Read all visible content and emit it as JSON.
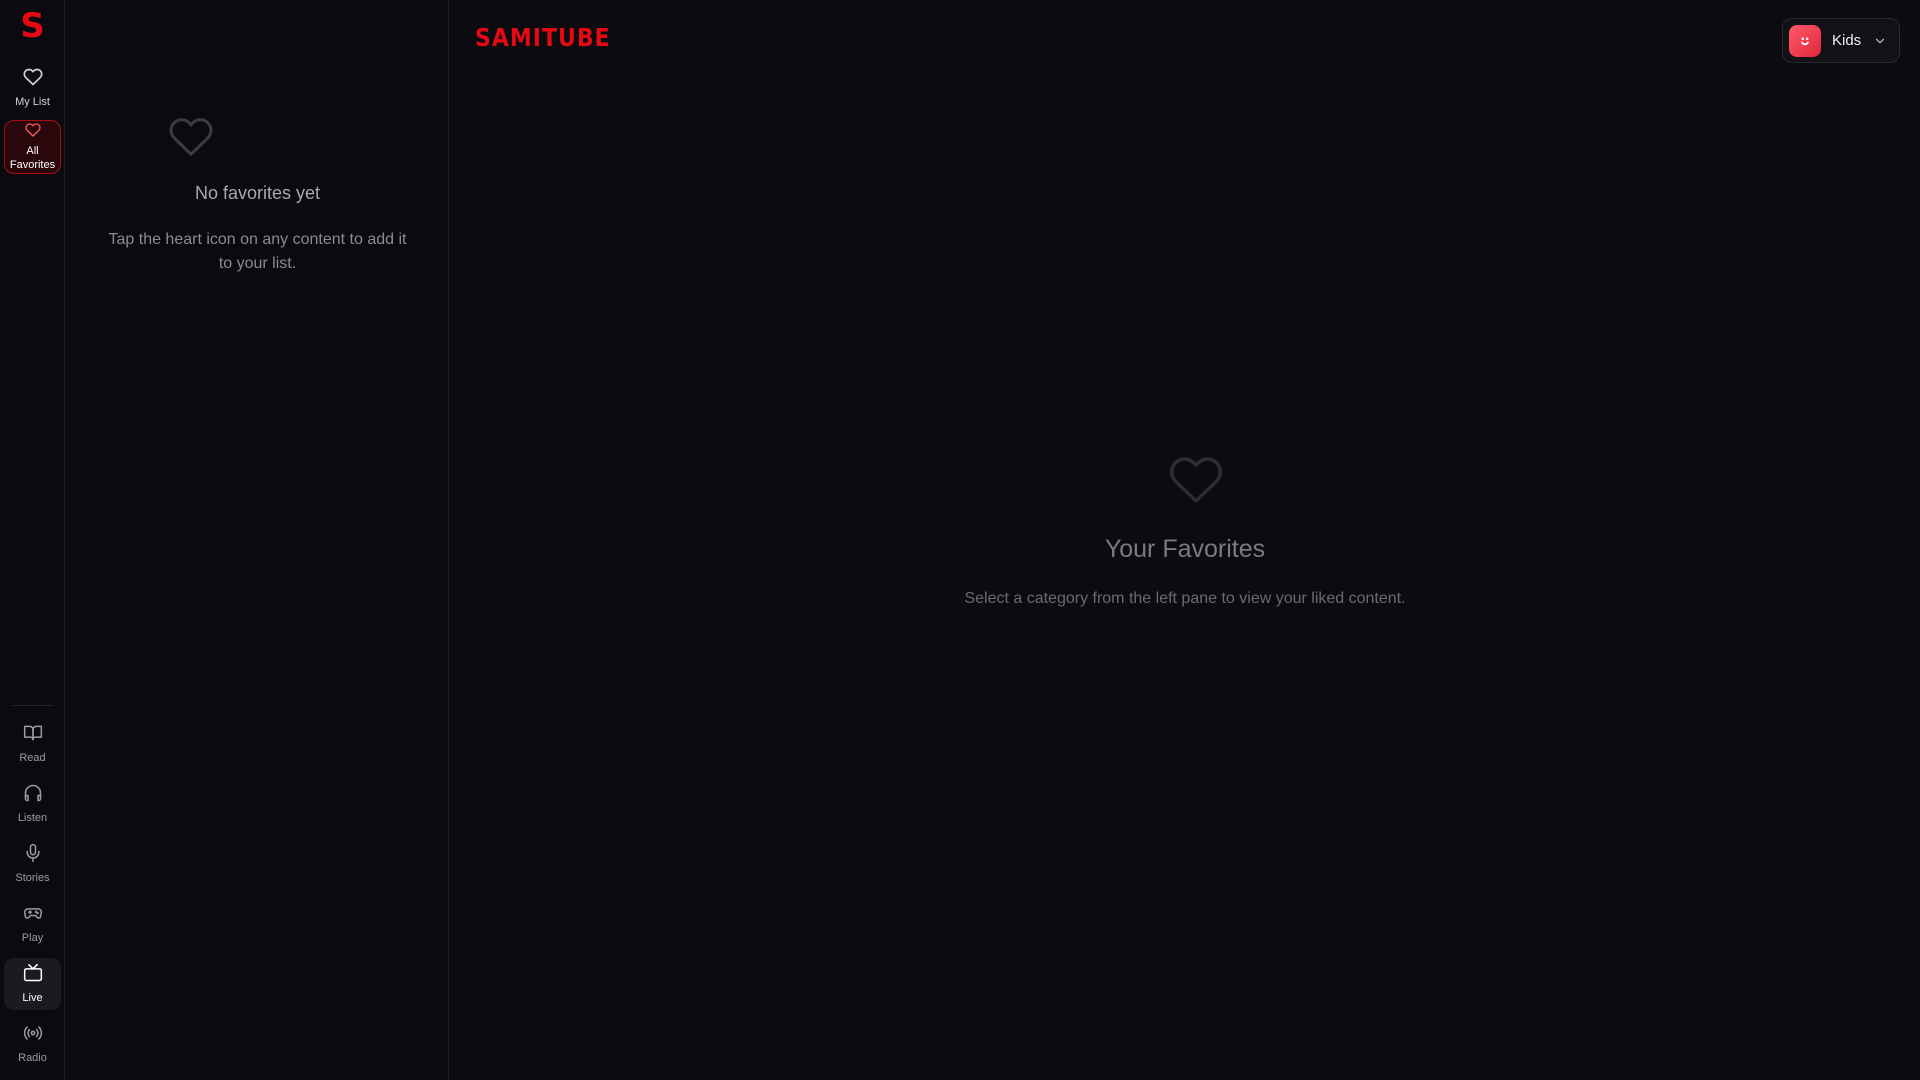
{
  "rail": {
    "logo": "S",
    "top_items": [
      {
        "label": "My List",
        "icon": "heart-icon"
      },
      {
        "label": "All Favorites",
        "icon": "heart-icon",
        "active": true
      }
    ],
    "bottom_items": [
      {
        "label": "Read",
        "icon": "book-icon"
      },
      {
        "label": "Listen",
        "icon": "headphones-icon"
      },
      {
        "label": "Stories",
        "icon": "microphone-icon"
      },
      {
        "label": "Play",
        "icon": "gamepad-icon"
      },
      {
        "label": "Live",
        "icon": "tv-icon",
        "active": true
      },
      {
        "label": "Radio",
        "icon": "radio-icon"
      }
    ]
  },
  "list_pane": {
    "empty_title": "No favorites yet",
    "empty_subtitle": "Tap the heart icon on any content to add it to your list."
  },
  "header": {
    "brand": "SAMITUBE",
    "profile_name": "Kids"
  },
  "main": {
    "placeholder_title": "Your Favorites",
    "placeholder_subtitle": "Select a category from the left pane to view your liked content."
  },
  "colors": {
    "accent": "#e50914",
    "background": "#0b0b0f"
  }
}
